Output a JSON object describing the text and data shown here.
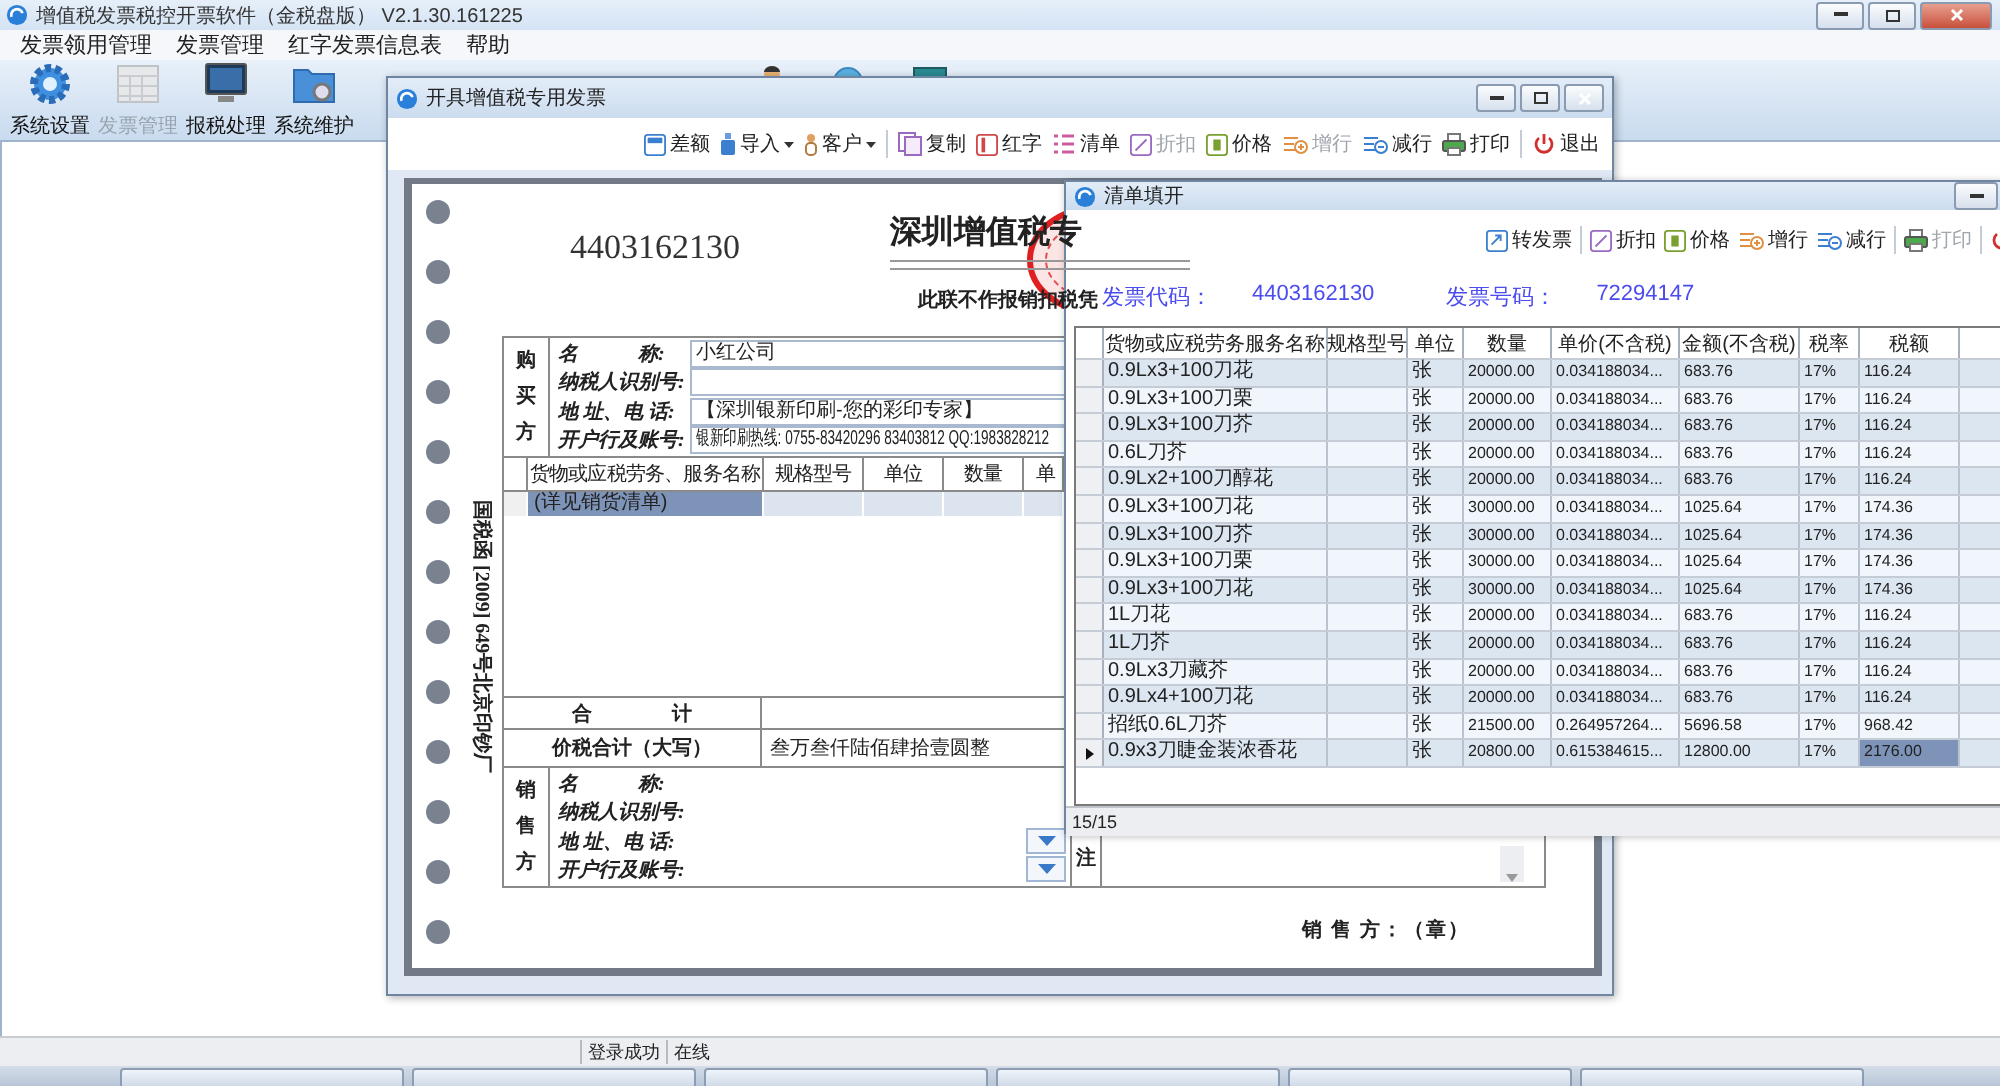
{
  "app": {
    "title": "增值税发票税控开票软件（金税盘版） V2.1.30.161225",
    "menu": [
      "发票领用管理",
      "发票管理",
      "红字发票信息表",
      "帮助"
    ],
    "toolbar": [
      {
        "kind": "settings",
        "label": "系统设置",
        "disabled": false
      },
      {
        "kind": "invoices",
        "label": "发票管理",
        "disabled": true
      },
      {
        "kind": "tax",
        "label": "报税处理",
        "disabled": false
      },
      {
        "kind": "maintenance",
        "label": "系统维护",
        "disabled": false
      }
    ]
  },
  "invoice_window": {
    "title": "开具增值税专用发票",
    "toolbar": [
      {
        "kind": "difference",
        "label": "差额",
        "disabled": false,
        "dropdown": false
      },
      {
        "kind": "import",
        "label": "导入",
        "disabled": false,
        "dropdown": true
      },
      {
        "kind": "customer",
        "label": "客户",
        "disabled": false,
        "dropdown": true
      },
      {
        "kind": "copy",
        "label": "复制",
        "disabled": false,
        "dropdown": false
      },
      {
        "kind": "red",
        "label": "红字",
        "disabled": false,
        "dropdown": false
      },
      {
        "kind": "list",
        "label": "清单",
        "disabled": false,
        "dropdown": false
      },
      {
        "kind": "discount",
        "label": "折扣",
        "disabled": true,
        "dropdown": false
      },
      {
        "kind": "price",
        "label": "价格",
        "disabled": false,
        "dropdown": false
      },
      {
        "kind": "add_row",
        "label": "增行",
        "disabled": true,
        "dropdown": false
      },
      {
        "kind": "remove_row",
        "label": "减行",
        "disabled": false,
        "dropdown": false
      },
      {
        "kind": "print",
        "label": "打印",
        "disabled": false,
        "dropdown": false
      },
      {
        "kind": "exit",
        "label": "退出",
        "disabled": false,
        "dropdown": false
      }
    ],
    "invoice_code": "4403162130",
    "heading": "深圳增值税专",
    "notice": "此联不作报销扣税凭",
    "side_print": "国税函 [2009] 649号北京印钞厂",
    "buyer": {
      "label": "购买方",
      "fields": [
        {
          "label": "名　　　称:",
          "value": "小红公司"
        },
        {
          "label": "纳税人识别号:"
        },
        {
          "label": "地 址、电 话:",
          "value": "【深圳银新印刷-您的彩印专家】"
        },
        {
          "label": "开户行及账号:",
          "value": "银新印刷热线: 0755-83420296 83403812 QQ:1983828212"
        }
      ]
    },
    "items": {
      "columns": [
        "货物或应税劳务、服务名称",
        "规格型号",
        "单位",
        "数量",
        "单"
      ],
      "rows": [
        {
          "name": "(详见销货清单)",
          "selected": true
        }
      ]
    },
    "total_label": "合　　　　计",
    "amount_in_words_label": "价税合计（大写）",
    "amount_in_words": "叁万叁仟陆佰肆拾壹圆整",
    "seller": {
      "label": "销售方",
      "fields": [
        {
          "label": "名　　　称:",
          "dropdown": false
        },
        {
          "label": "纳税人识别号:",
          "dropdown": false
        },
        {
          "label": "地 址、电 话:",
          "dropdown": true
        },
        {
          "label": "开户行及账号:",
          "dropdown": true
        }
      ]
    },
    "note_label": "注",
    "signature": "销 售 方：（章）"
  },
  "list_window": {
    "title": "清单填开",
    "toolbar": [
      {
        "kind": "convert",
        "label": "转发票",
        "disabled": false
      },
      {
        "kind": "discount",
        "label": "折扣",
        "disabled": false
      },
      {
        "kind": "price",
        "label": "价格",
        "disabled": false
      },
      {
        "kind": "add_row",
        "label": "增行",
        "disabled": false
      },
      {
        "kind": "remove_row",
        "label": "减行",
        "disabled": false
      },
      {
        "kind": "print",
        "label": "打印",
        "disabled": true
      }
    ],
    "code_label": "发票代码：",
    "code": "4403162130",
    "number_label": "发票号码：",
    "number": "72294147",
    "columns": [
      "货物或应税劳务服务名称",
      "规格型号",
      "单位",
      "数量",
      "单价(不含税)",
      "金额(不含税)",
      "税率",
      "税额"
    ],
    "rows": [
      {
        "cells": [
          "0.9Lx3+100刀花",
          "",
          "张",
          "20000.00",
          "0.034188034...",
          "683.76",
          "17%",
          "116.24"
        ],
        "selected": false
      },
      {
        "cells": [
          "0.9Lx3+100刀栗",
          "",
          "张",
          "20000.00",
          "0.034188034...",
          "683.76",
          "17%",
          "116.24"
        ],
        "selected": false
      },
      {
        "cells": [
          "0.9Lx3+100刀芥",
          "",
          "张",
          "20000.00",
          "0.034188034...",
          "683.76",
          "17%",
          "116.24"
        ],
        "selected": false
      },
      {
        "cells": [
          "0.6L刀芥",
          "",
          "张",
          "20000.00",
          "0.034188034...",
          "683.76",
          "17%",
          "116.24"
        ],
        "selected": false
      },
      {
        "cells": [
          "0.9Lx2+100刀醇花",
          "",
          "张",
          "20000.00",
          "0.034188034...",
          "683.76",
          "17%",
          "116.24"
        ],
        "selected": false
      },
      {
        "cells": [
          "0.9Lx3+100刀花",
          "",
          "张",
          "30000.00",
          "0.034188034...",
          "1025.64",
          "17%",
          "174.36"
        ],
        "selected": false
      },
      {
        "cells": [
          "0.9Lx3+100刀芥",
          "",
          "张",
          "30000.00",
          "0.034188034...",
          "1025.64",
          "17%",
          "174.36"
        ],
        "selected": false
      },
      {
        "cells": [
          "0.9Lx3+100刀栗",
          "",
          "张",
          "30000.00",
          "0.034188034...",
          "1025.64",
          "17%",
          "174.36"
        ],
        "selected": false
      },
      {
        "cells": [
          "0.9Lx3+100刀花",
          "",
          "张",
          "30000.00",
          "0.034188034...",
          "1025.64",
          "17%",
          "174.36"
        ],
        "selected": false
      },
      {
        "cells": [
          "1L刀花",
          "",
          "张",
          "20000.00",
          "0.034188034...",
          "683.76",
          "17%",
          "116.24"
        ],
        "selected": false
      },
      {
        "cells": [
          "1L刀芥",
          "",
          "张",
          "20000.00",
          "0.034188034...",
          "683.76",
          "17%",
          "116.24"
        ],
        "selected": false
      },
      {
        "cells": [
          "0.9Lx3刀藏芥",
          "",
          "张",
          "20000.00",
          "0.034188034...",
          "683.76",
          "17%",
          "116.24"
        ],
        "selected": false
      },
      {
        "cells": [
          "0.9Lx4+100刀花",
          "",
          "张",
          "20000.00",
          "0.034188034...",
          "683.76",
          "17%",
          "116.24"
        ],
        "selected": false
      },
      {
        "cells": [
          "招纸0.6L刀芥",
          "",
          "张",
          "21500.00",
          "0.264957264...",
          "5696.58",
          "17%",
          "968.42"
        ],
        "selected": false
      },
      {
        "cells": [
          "0.9x3刀睫金装浓香花",
          "",
          "张",
          "20800.00",
          "0.615384615...",
          "12800.00",
          "17%",
          "2176.00"
        ],
        "selected": true
      }
    ],
    "footer": "15/15"
  },
  "status_bar": [
    "登录成功",
    "在线"
  ]
}
